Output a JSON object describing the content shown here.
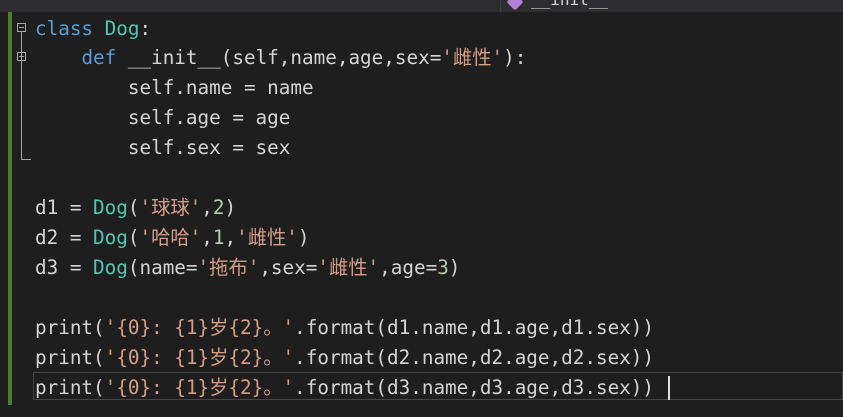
{
  "nav": {
    "member_label": "__init__"
  },
  "code": {
    "l1": {
      "kw": "class",
      "sp": " ",
      "name": "Dog",
      "colon": ":"
    },
    "l2": {
      "indent": "    ",
      "kw": "def",
      "sp": " ",
      "fn": "__init__",
      "open": "(self,name,age,sex=",
      "str": "'雌性'",
      "close": "):"
    },
    "l3": {
      "text": "        self.name = name"
    },
    "l4": {
      "text": "        self.age = age"
    },
    "l5": {
      "text": "        self.sex = sex"
    },
    "l7": {
      "a": "d1 = ",
      "cls": "Dog",
      "b": "(",
      "s1": "'球球'",
      "c": ",",
      "n1": "2",
      "d": ")"
    },
    "l8": {
      "a": "d2 = ",
      "cls": "Dog",
      "b": "(",
      "s1": "'哈哈'",
      "c": ",",
      "n1": "1",
      "e": ",",
      "s2": "'雌性'",
      "d": ")"
    },
    "l9": {
      "a": "d3 = ",
      "cls": "Dog",
      "b": "(name=",
      "s1": "'拖布'",
      "c": ",sex=",
      "s2": "'雌性'",
      "e": ",age=",
      "n1": "3",
      "d": ")"
    },
    "l11": {
      "fn": "print",
      "b": "(",
      "s": "'{0}: {1}岁{2}。'",
      "rest": ".format(d1.name,d1.age,d1.sex))"
    },
    "l12": {
      "fn": "print",
      "b": "(",
      "s": "'{0}: {1}岁{2}。'",
      "rest": ".format(d2.name,d2.age,d2.sex))"
    },
    "l13": {
      "fn": "print",
      "b": "(",
      "s": "'{0}: {1}岁{2}。'",
      "rest": ".format(d3.name,d3.age,d3.sex))"
    }
  },
  "colors": {
    "background": "#1e1e1e",
    "keyword": "#569cd6",
    "class_name": "#4ec9b0",
    "string": "#d69d85",
    "number": "#b5cea8",
    "text": "#d4d4d4",
    "change_bar": "#4e7c2e"
  },
  "icons": {
    "fold": "minus-box-icon",
    "member": "method-icon"
  }
}
